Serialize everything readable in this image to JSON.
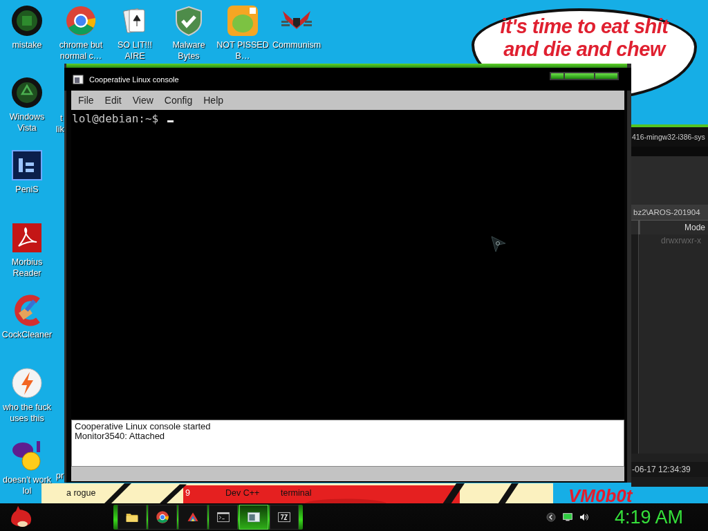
{
  "desktop_icons_top": [
    {
      "label": "mistake",
      "kind": "orb"
    },
    {
      "label": "chrome but normal c…",
      "kind": "browser"
    },
    {
      "label": "SO LIT!!! AIRE",
      "kind": "cards"
    },
    {
      "label": "Malware Bytes",
      "kind": "shield"
    },
    {
      "label": "NOT PISSED B…",
      "kind": "game"
    },
    {
      "label": "Communism",
      "kind": "emblem"
    }
  ],
  "desktop_icons_left": [
    {
      "label": "Windows Vista",
      "kind": "recycle"
    },
    {
      "label": "PeniS",
      "kind": "ps"
    },
    {
      "label": "Morbius Reader",
      "kind": "pdf"
    },
    {
      "label": "CockCleaner",
      "kind": "cleaner"
    },
    {
      "label": "who the fuck uses this",
      "kind": "bolt"
    },
    {
      "label": "doesn't work lol",
      "kind": "messenger"
    }
  ],
  "hidden_labels": [
    "t",
    "lik",
    "pr",
    "a rogue",
    "9",
    "Dev C++",
    "terminal"
  ],
  "wallpaper": {
    "bubble_lines": [
      "it's time to eat shit",
      "and die and chew"
    ],
    "caption": "VM0b0t"
  },
  "background_window": {
    "title": "416-mingw32-i386-sys",
    "path": "bz2\\AROS-201904",
    "columns": [
      "Mode"
    ],
    "rows": [
      [
        "drwxrwxr-x"
      ]
    ],
    "status": "-06-17 12:34:39"
  },
  "console_window": {
    "title": "Cooperative Linux console",
    "menu": [
      "File",
      "Edit",
      "View",
      "Config",
      "Help"
    ],
    "prompt": "lol@debian:~$",
    "log": [
      "Cooperative Linux console started",
      "Monitor3540: Attached"
    ]
  },
  "taskbar": {
    "items": [
      {
        "kind": "folder",
        "selected": false
      },
      {
        "kind": "browser",
        "selected": false
      },
      {
        "kind": "triangle",
        "selected": false
      },
      {
        "kind": "terminal",
        "selected": false
      },
      {
        "kind": "console",
        "selected": true
      },
      {
        "kind": "archive",
        "selected": false
      }
    ],
    "tray": [
      {
        "kind": "arrow"
      },
      {
        "kind": "monitor"
      },
      {
        "kind": "speaker"
      }
    ],
    "clock": "4:19 AM"
  }
}
